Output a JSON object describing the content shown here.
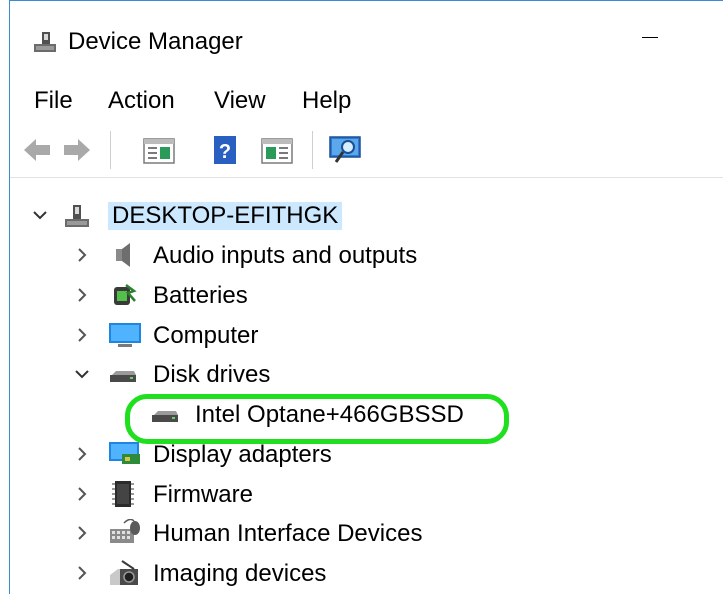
{
  "window": {
    "title": "Device Manager",
    "menu": [
      "File",
      "Action",
      "View",
      "Help"
    ]
  },
  "tree": {
    "root": "DESKTOP-EFITHGK",
    "categories": [
      {
        "label": "Audio inputs and outputs",
        "icon": "speaker-icon",
        "expanded": false
      },
      {
        "label": "Batteries",
        "icon": "battery-icon",
        "expanded": false
      },
      {
        "label": "Computer",
        "icon": "monitor-icon",
        "expanded": false
      },
      {
        "label": "Disk drives",
        "icon": "disk-drive-icon",
        "expanded": true,
        "children": [
          "Intel Optane+466GBSSD"
        ]
      },
      {
        "label": "Display adapters",
        "icon": "display-adapter-icon",
        "expanded": false
      },
      {
        "label": "Firmware",
        "icon": "firmware-icon",
        "expanded": false
      },
      {
        "label": "Human Interface Devices",
        "icon": "hid-icon",
        "expanded": false
      },
      {
        "label": "Imaging devices",
        "icon": "camera-icon",
        "expanded": false
      }
    ]
  },
  "highlight": {
    "color": "#1fdf1f",
    "target": "Intel Optane+466GBSSD"
  },
  "colors": {
    "accent": "#3c8ad6",
    "selection": "#cce8ff"
  }
}
